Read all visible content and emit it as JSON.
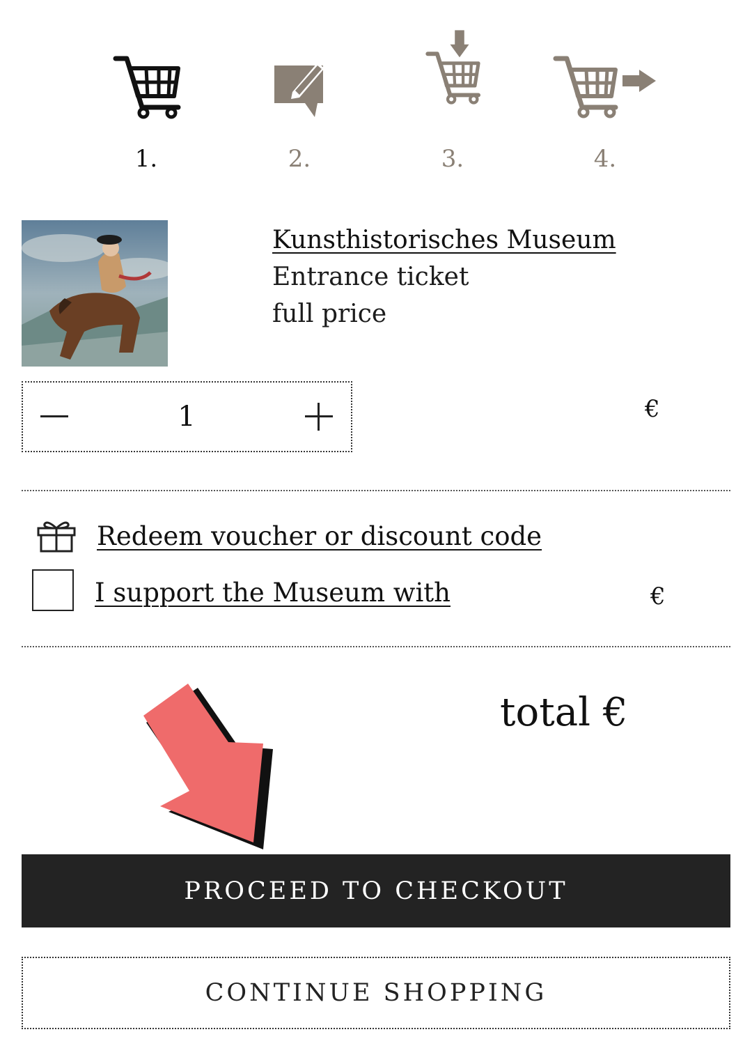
{
  "steps": [
    {
      "number": "1.",
      "icon": "cart-icon",
      "active": true
    },
    {
      "number": "2.",
      "icon": "edit-note-icon",
      "active": false
    },
    {
      "number": "3.",
      "icon": "cart-add-icon",
      "active": false
    },
    {
      "number": "4.",
      "icon": "cart-forward-icon",
      "active": false
    }
  ],
  "product": {
    "title": "Kunsthistorisches Museum",
    "type": "Entrance ticket",
    "price_category": "full price",
    "image_icon": "painting-thumbnail",
    "quantity": "1",
    "currency": "€"
  },
  "voucher": {
    "label": "Redeem voucher or discount code",
    "icon": "gift-icon"
  },
  "donation": {
    "label": "I support the Museum with",
    "currency": "€",
    "checked": false
  },
  "total": {
    "label": "total €"
  },
  "actions": {
    "checkout_label": "PROCEED TO CHECKOUT",
    "continue_label": "CONTINUE SHOPPING"
  },
  "colors": {
    "active": "#111111",
    "inactive": "#8a8075",
    "primary_button": "#232323",
    "arrow": "#ef6b6b"
  }
}
